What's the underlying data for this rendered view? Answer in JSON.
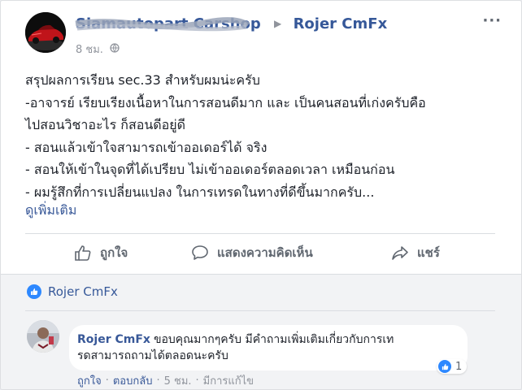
{
  "post": {
    "author_page": "Siamautopart Carshop",
    "author_user": "Rojer CmFx",
    "time": "8 ชม.",
    "more_label": "···",
    "lines": [
      "สรุปผลการเรียน sec.33 สำหรับผมน่ะครับ",
      "-อาจารย์ เรียบเรียงเนื้อหาในการสอนดีมาก และ เป็นคนสอนที่เก่งครับคือ",
      "ไปสอนวิชาอะไร ก็สอนดีอยู่ดี",
      "- สอนแล้วเข้าใจสามารถเข้าออเดอร์ได้ จริง",
      "- สอนให้เข้าในจุดที่ได้เปรียบ ไม่เข้าออเดอร์ตลอดเวลา เหมือนก่อน",
      "- ผมรู้สึกที่การเปลี่ยนแปลง ในการเทรดในทางที่ดีขึ้นมากครับ..."
    ],
    "see_more": "ดูเพิ่มเติม"
  },
  "actions": {
    "like": "ถูกใจ",
    "comment": "แสดงความคิดเห็น",
    "share": "แชร์"
  },
  "reactions": {
    "likers": "Rojer CmFx"
  },
  "comment": {
    "author": "Rojer CmFx",
    "text_line1": "ขอบคุณมากๆครับ มีคำถามเพิ่มเติมเกี่ยวกับการเท",
    "text_line2": "รดสามารถถามได้ตลอดนะครับ",
    "like_label": "ถูกใจ",
    "reply_label": "ตอบกลับ",
    "time": "5 ชม.",
    "edited_label": "มีการแก้ไข",
    "reaction_count": "1"
  },
  "colors": {
    "link_blue": "#385898",
    "like_blue": "#2d88ff",
    "meta_gray": "#90949c"
  }
}
